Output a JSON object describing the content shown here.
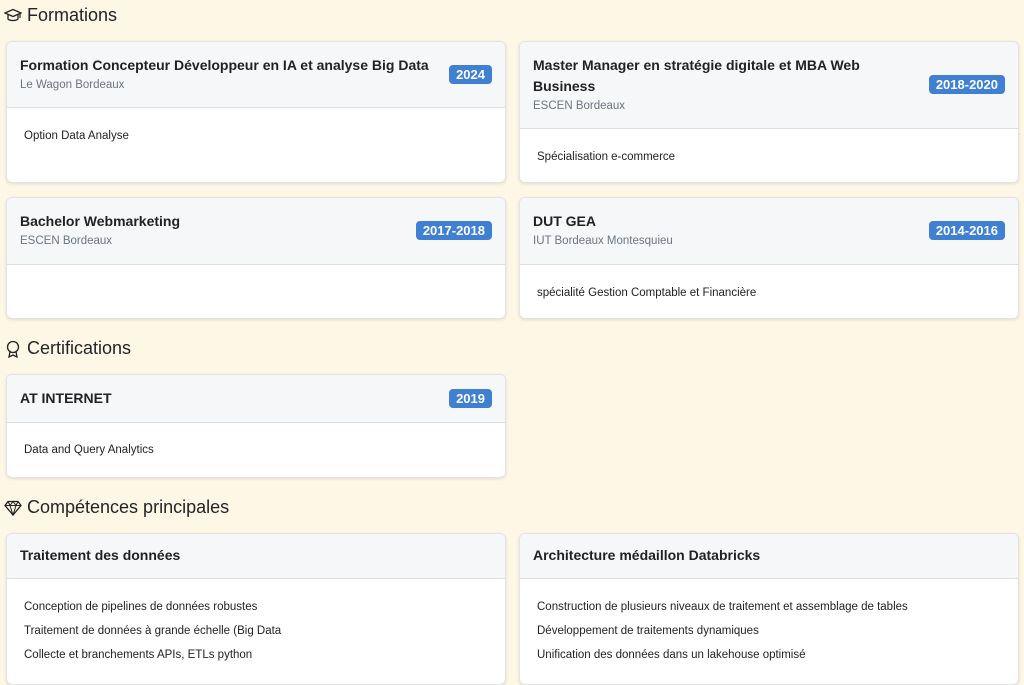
{
  "sections": {
    "formations": {
      "title": "Formations",
      "icon": "graduation-cap-icon"
    },
    "certifications": {
      "title": "Certifications",
      "icon": "award-icon"
    },
    "competences": {
      "title": "Compétences principales",
      "icon": "gem-icon"
    }
  },
  "formations": [
    {
      "title": "Formation Concepteur Développeur en IA et analyse Big Data",
      "school": "Le Wagon Bordeaux",
      "year": "2024",
      "detail": "Option Data Analyse"
    },
    {
      "title_line1": "Master Manager en stratégie digitale et MBA Web",
      "title_line2": "Business",
      "school": "ESCEN Bordeaux",
      "year": "2018-2020",
      "detail": "Spécialisation e-commerce"
    },
    {
      "title": "Bachelor Webmarketing",
      "school": "ESCEN Bordeaux",
      "year": "2017-2018",
      "detail": ""
    },
    {
      "title": "DUT GEA",
      "school": "IUT Bordeaux Montesquieu",
      "year": "2014-2016",
      "detail": "spécialité Gestion Comptable et Financière"
    }
  ],
  "certifications": [
    {
      "title": "AT INTERNET",
      "year": "2019",
      "detail": "Data and Query Analytics"
    }
  ],
  "competences": [
    {
      "title": "Traitement des données",
      "items": [
        "Conception de pipelines de données robustes",
        "Traitement de données à grande échelle (Big Data",
        "Collecte et branchements APIs, ETLs python"
      ]
    },
    {
      "title": "Architecture médaillon Databricks",
      "items": [
        "Construction de plusieurs niveaux de traitement et assemblage de tables",
        "Développement de traitements dynamiques",
        "Unification des données dans un lakehouse optimisé"
      ]
    }
  ]
}
